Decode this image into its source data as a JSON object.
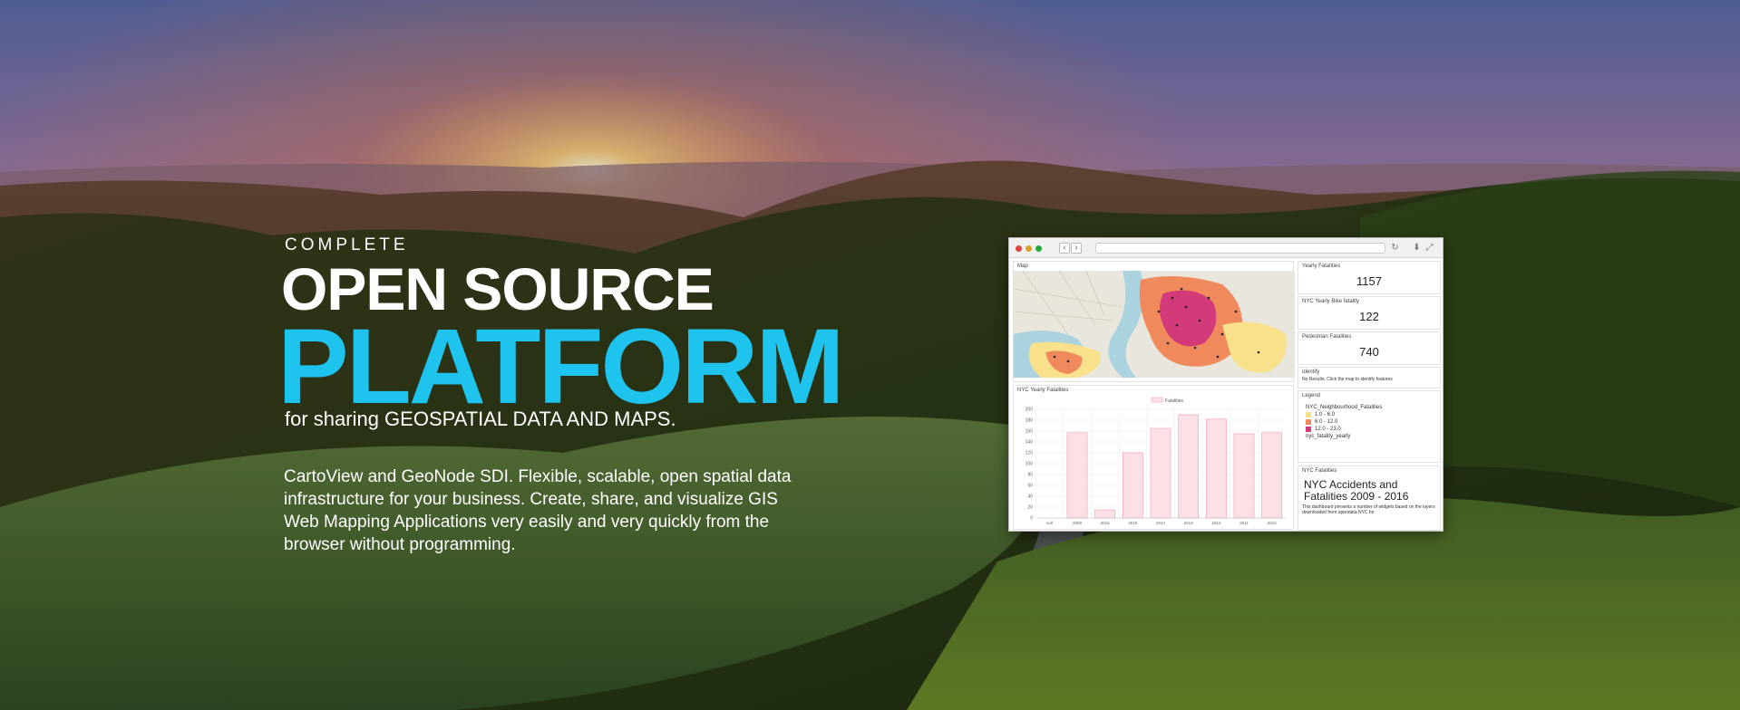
{
  "hero": {
    "eyebrow": "COMPLETE",
    "headline": "OPEN SOURCE",
    "headline_accent": "PLATFORM",
    "tagline": "for sharing GEOSPATIAL DATA AND MAPS.",
    "description": "CartoView and GeoNode SDI. Flexible, scalable, open spatial data infrastructure for your business. Create, share, and visualize GIS Web Mapping Applications very easily and very quickly from the browser without programming.",
    "accent_color": "#1ec3ee"
  },
  "dashboard": {
    "map_title": "Map",
    "chart_title": "NYC Yearly Fatalities",
    "chart_legend": "Fatalities",
    "kpis": [
      {
        "label": "Yearly Fatalities",
        "value": "1157"
      },
      {
        "label": "NYC Yearly Bike fatality",
        "value": "122"
      },
      {
        "label": "Pedestrian Fatalities",
        "value": "740"
      }
    ],
    "identify": {
      "title": "Identify",
      "text": "No Results. Click the map to identify features"
    },
    "legend": {
      "title": "Legend",
      "layer": "NYC_Neighbourhood_Fatalities",
      "items": [
        {
          "label": "1.0 - 6.0",
          "color": "#f9e08a"
        },
        {
          "label": "6.0 - 12.0",
          "color": "#f08a5c"
        },
        {
          "label": "12.0 - 23.0",
          "color": "#d23a7a"
        }
      ],
      "layer2": "nyc_fatality_yearly"
    },
    "info": {
      "title": "NYC Fatalities",
      "heading": "NYC Accidents and Fatalities 2009 - 2016",
      "text": "This dashboard presents a number of widgets based on the layers downloaded from opendata NYC for"
    }
  },
  "chart_data": {
    "type": "bar",
    "title": "NYC Yearly Fatalities",
    "categories": [
      "null",
      "2009",
      "2016",
      "2015",
      "2014",
      "2013",
      "2012",
      "2011",
      "2010"
    ],
    "series": [
      {
        "name": "Fatalities",
        "values": [
          0,
          157,
          15,
          120,
          165,
          190,
          182,
          155,
          157
        ]
      }
    ],
    "ylim": [
      0,
      200
    ],
    "yticks": [
      "0",
      "20",
      "40",
      "60",
      "80",
      "100",
      "120",
      "140",
      "160",
      "180",
      "200"
    ],
    "colors": {
      "bar_fill": "#fde0e6",
      "bar_stroke": "#f49ab0"
    }
  }
}
